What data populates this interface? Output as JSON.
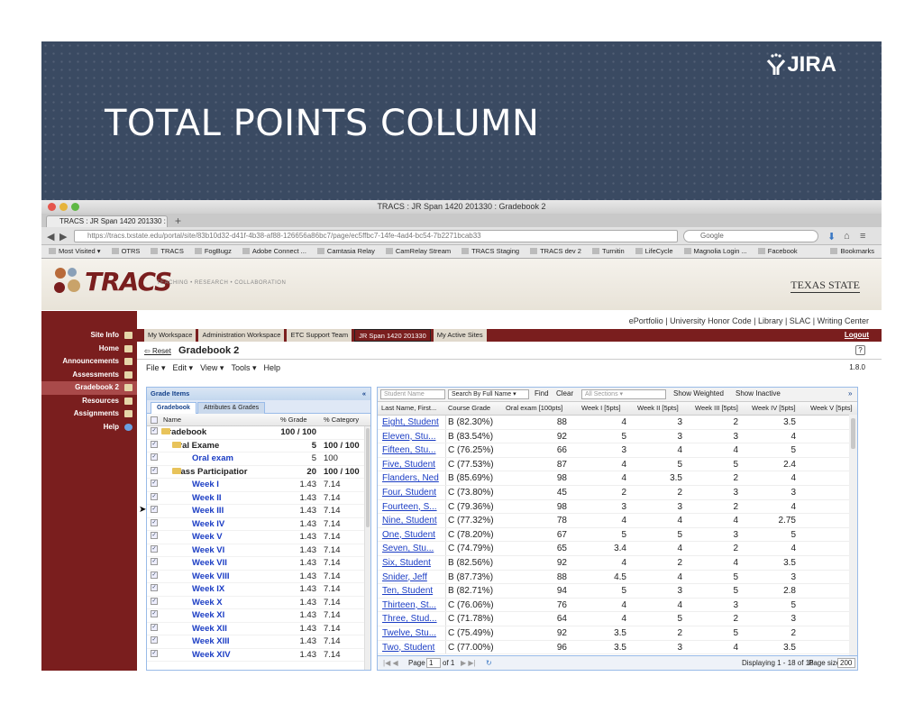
{
  "slide": {
    "title": "TOTAL POINTS COLUMN",
    "brand": "JIRA"
  },
  "browser": {
    "window_title": "TRACS : JR Span 1420 201330 : Gradebook 2",
    "tab_title": "TRACS : JR Span 1420 201330 : ...",
    "url": "https://tracs.txstate.edu/portal/site/83b10d32-d41f-4b38-af88-126656a86bc7/page/ec5ffbc7-14fe-4ad4-bc54-7b2271bcab33",
    "search_placeholder": "Google",
    "bookmarks": [
      "Most Visited ▾",
      "OTRS",
      "TRACS",
      "FogBugz",
      "Adobe Connect ...",
      "Camtasia Relay",
      "CamRelay Stream",
      "TRACS Staging",
      "TRACS dev 2",
      "Turnitin",
      "LifeCycle",
      "Magnolia Login ...",
      "Facebook"
    ],
    "bookmarks_menu": "Bookmarks"
  },
  "tracs": {
    "logo": "TRACS",
    "tagline": "TEACHING • RESEARCH • COLLABORATION",
    "university": "TEXAS STATE",
    "top_links": "ePortfolio | University Honor Code | Library | SLAC | Writing Center",
    "sites": [
      "My Workspace",
      "Administration Workspace",
      "ETC Support Team",
      "JR Span 1420 201330",
      "My Active Sites"
    ],
    "logout": "Logout",
    "sidebar": [
      "Site Info",
      "Home",
      "Announcements",
      "Assessments",
      "Gradebook 2",
      "Resources",
      "Assignments",
      "Help"
    ]
  },
  "gradebook": {
    "reset": "Reset",
    "title": "Gradebook 2",
    "version": "1.8.0",
    "menu": [
      "File ▾",
      "Edit ▾",
      "View ▾",
      "Tools ▾",
      "Help"
    ],
    "items_panel": {
      "header": "Grade Items",
      "tabs": [
        "Gradebook",
        "Attributes & Grades"
      ],
      "columns": [
        "Name",
        "% Grade",
        "% Category"
      ],
      "rows": [
        {
          "name": "Gradebook",
          "grade": "100 / 100",
          "category": ""
        },
        {
          "name": "Oral Exame",
          "grade": "5",
          "category": "100 / 100"
        },
        {
          "name": "Oral exam",
          "grade": "5",
          "category": "100"
        },
        {
          "name": "Class Participatior",
          "grade": "20",
          "category": "100 / 100"
        },
        {
          "name": "Week I",
          "grade": "1.43",
          "category": "7.14"
        },
        {
          "name": "Week II",
          "grade": "1.43",
          "category": "7.14"
        },
        {
          "name": "Week III",
          "grade": "1.43",
          "category": "7.14"
        },
        {
          "name": "Week IV",
          "grade": "1.43",
          "category": "7.14"
        },
        {
          "name": "Week V",
          "grade": "1.43",
          "category": "7.14"
        },
        {
          "name": "Week VI",
          "grade": "1.43",
          "category": "7.14"
        },
        {
          "name": "Week VII",
          "grade": "1.43",
          "category": "7.14"
        },
        {
          "name": "Week VIII",
          "grade": "1.43",
          "category": "7.14"
        },
        {
          "name": "Week IX",
          "grade": "1.43",
          "category": "7.14"
        },
        {
          "name": "Week X",
          "grade": "1.43",
          "category": "7.14"
        },
        {
          "name": "Week XI",
          "grade": "1.43",
          "category": "7.14"
        },
        {
          "name": "Week XII",
          "grade": "1.43",
          "category": "7.14"
        },
        {
          "name": "Week XIII",
          "grade": "1.43",
          "category": "7.14"
        },
        {
          "name": "Week XIV",
          "grade": "1.43",
          "category": "7.14"
        }
      ]
    },
    "grid": {
      "student_placeholder": "Student Name",
      "search_by": "Search By Full Name",
      "find": "Find",
      "clear": "Clear",
      "sections": "All Sections",
      "show_weighted": "Show Weighted",
      "show_inactive": "Show Inactive",
      "columns": [
        "Last Name, First...",
        "Course Grade",
        "Oral exam [100pts]",
        "Week I [5pts]",
        "Week II [5pts]",
        "Week III [5pts]",
        "Week IV [5pts]",
        "Week V [5pts]"
      ],
      "rows": [
        {
          "name": "Eight, Student",
          "grade": "B (82.30%)",
          "oral": "88",
          "w1": "4",
          "w2": "3",
          "w3": "2",
          "w4": "3.5",
          "w5": "2"
        },
        {
          "name": "Eleven, Stu...",
          "grade": "B (83.54%)",
          "oral": "92",
          "w1": "5",
          "w2": "3",
          "w3": "3",
          "w4": "4",
          "w5": ""
        },
        {
          "name": "Fifteen, Stu...",
          "grade": "C (76.25%)",
          "oral": "66",
          "w1": "3",
          "w2": "4",
          "w3": "4",
          "w4": "5",
          "w5": ""
        },
        {
          "name": "Five, Student",
          "grade": "C (77.53%)",
          "oral": "87",
          "w1": "4",
          "w2": "5",
          "w3": "5",
          "w4": "2.4",
          "w5": ""
        },
        {
          "name": "Flanders, Ned",
          "grade": "B (85.69%)",
          "oral": "98",
          "w1": "4",
          "w2": "3.5",
          "w3": "2",
          "w4": "4",
          "w5": ""
        },
        {
          "name": "Four, Student",
          "grade": "C (73.80%)",
          "oral": "45",
          "w1": "2",
          "w2": "2",
          "w3": "3",
          "w4": "3",
          "w5": ""
        },
        {
          "name": "Fourteen, S...",
          "grade": "C (79.36%)",
          "oral": "98",
          "w1": "3",
          "w2": "3",
          "w3": "2",
          "w4": "4",
          "w5": ""
        },
        {
          "name": "Nine, Student",
          "grade": "C (77.32%)",
          "oral": "78",
          "w1": "4",
          "w2": "4",
          "w3": "4",
          "w4": "2.75",
          "w5": ""
        },
        {
          "name": "One, Student",
          "grade": "C (78.20%)",
          "oral": "67",
          "w1": "5",
          "w2": "5",
          "w3": "3",
          "w4": "5",
          "w5": ""
        },
        {
          "name": "Seven, Stu...",
          "grade": "C (74.79%)",
          "oral": "65",
          "w1": "3.4",
          "w2": "4",
          "w3": "2",
          "w4": "4",
          "w5": ""
        },
        {
          "name": "Six, Student",
          "grade": "B (82.56%)",
          "oral": "92",
          "w1": "4",
          "w2": "2",
          "w3": "4",
          "w4": "3.5",
          "w5": ""
        },
        {
          "name": "Snider, Jeff",
          "grade": "B (87.73%)",
          "oral": "88",
          "w1": "4.5",
          "w2": "4",
          "w3": "5",
          "w4": "3",
          "w5": ""
        },
        {
          "name": "Ten, Student",
          "grade": "B (82.71%)",
          "oral": "94",
          "w1": "5",
          "w2": "3",
          "w3": "5",
          "w4": "2.8",
          "w5": ""
        },
        {
          "name": "Thirteen, St...",
          "grade": "C (76.06%)",
          "oral": "76",
          "w1": "4",
          "w2": "4",
          "w3": "3",
          "w4": "5",
          "w5": ""
        },
        {
          "name": "Three, Stud...",
          "grade": "C (71.78%)",
          "oral": "64",
          "w1": "4",
          "w2": "5",
          "w3": "2",
          "w4": "3",
          "w5": ""
        },
        {
          "name": "Twelve, Stu...",
          "grade": "C (75.49%)",
          "oral": "92",
          "w1": "3.5",
          "w2": "2",
          "w3": "5",
          "w4": "2",
          "w5": ""
        },
        {
          "name": "Two, Student",
          "grade": "C (77.00%)",
          "oral": "96",
          "w1": "3.5",
          "w2": "3",
          "w3": "4",
          "w4": "3.5",
          "w5": ""
        }
      ],
      "pager": {
        "page_label": "Page",
        "page": "1",
        "of": "of 1",
        "displaying": "Displaying 1 - 18 of 18",
        "page_size_label": "Page size:",
        "page_size": "200"
      }
    }
  }
}
